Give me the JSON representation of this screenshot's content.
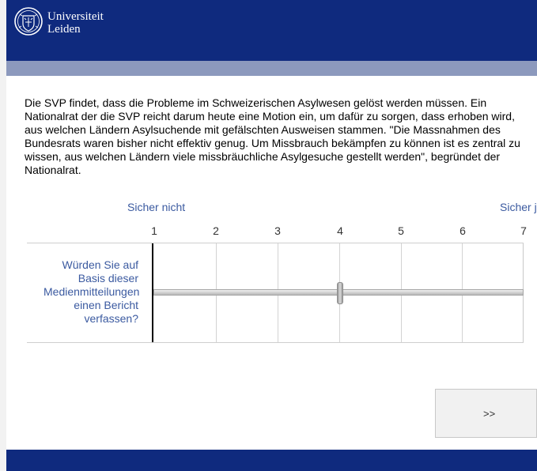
{
  "header": {
    "brand_line1": "Universiteit",
    "brand_line2": "Leiden",
    "logo_icon": "leiden-seal-icon"
  },
  "colors": {
    "header_bg": "#0f2a7e",
    "subbar_bg": "#8c99bd",
    "label_blue": "#3b5aa0"
  },
  "question": {
    "text": "Die SVP findet, dass die Probleme im Schweizerischen Asylwesen gelöst werden müssen. Ein Nationalrat der  die SVP reicht darum heute eine Motion ein, um dafür zu sorgen, dass erhoben wird, aus welchen Ländern Asylsuchende mit gefälschten Ausweisen stammen. \"Die Massnahmen des Bundesrats waren bisher nicht effektiv genug. Um Missbrauch bekämpfen zu können ist es zentral zu wissen, aus welchen Ländern viele missbräuchliche Asylgesuche gestellt werden\", begründet der Nationalrat."
  },
  "scale": {
    "anchor_left": "Sicher nicht",
    "anchor_right": "Sicher j",
    "ticks": [
      "1",
      "2",
      "3",
      "4",
      "5",
      "6",
      "7"
    ],
    "statement": "Würden Sie auf Basis dieser Medienmitteilungen einen Bericht verfassen?",
    "slider_value": 4
  },
  "navigation": {
    "next_label": ">>"
  }
}
